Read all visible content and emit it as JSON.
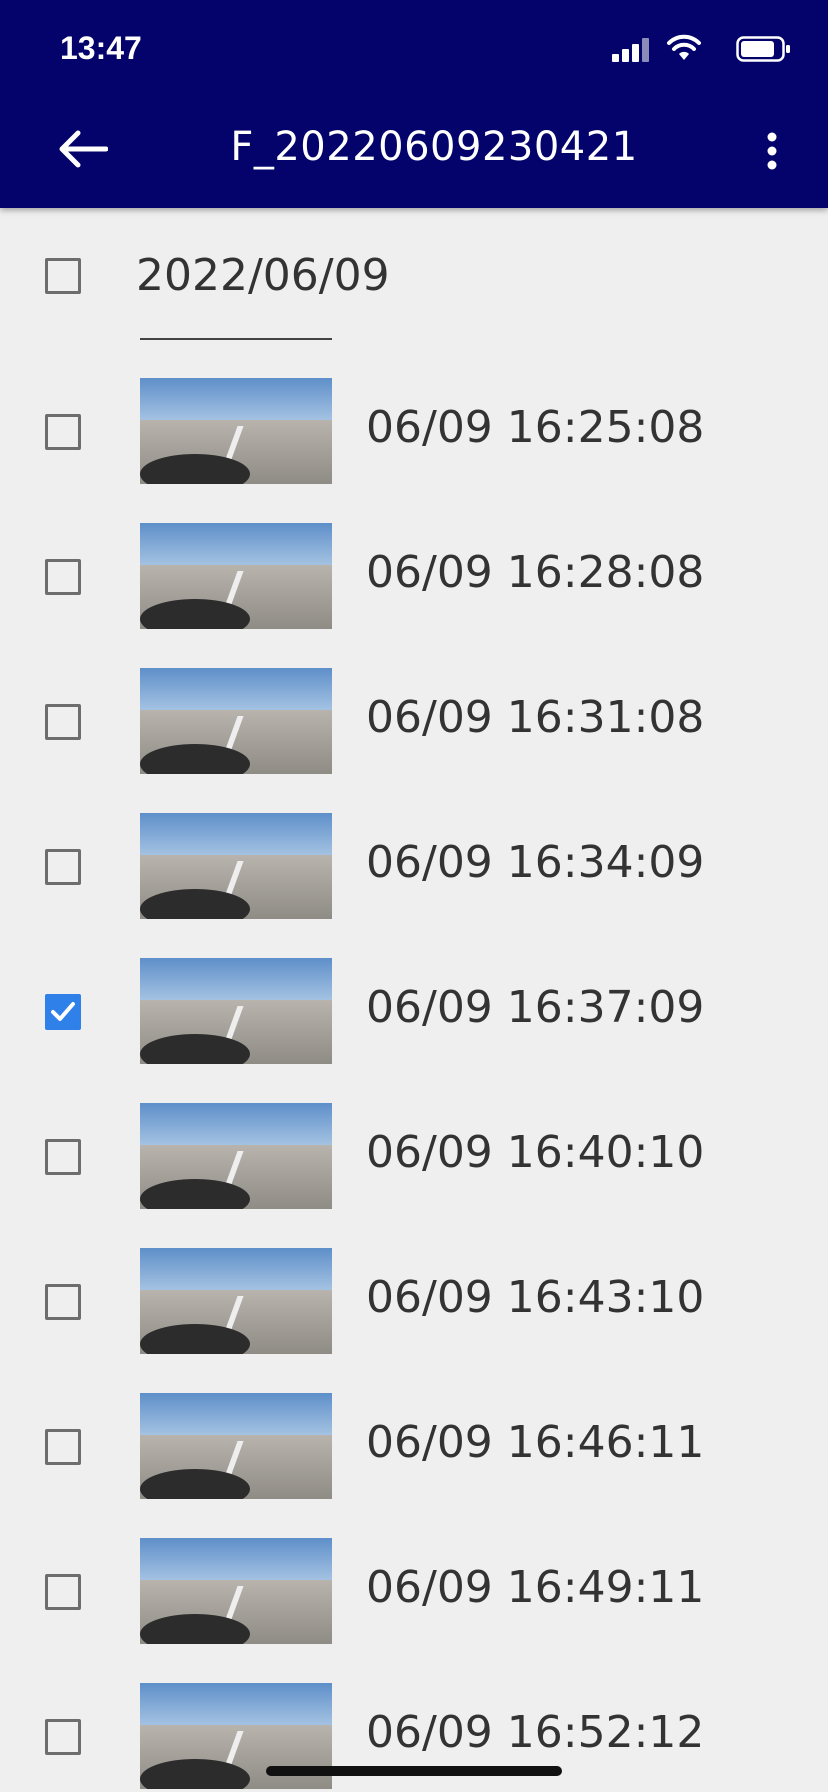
{
  "status_bar": {
    "time": "13:47"
  },
  "header": {
    "title": "F_20220609230421"
  },
  "group": {
    "date": "2022/06/09",
    "checked": false
  },
  "items": [
    {
      "time": "06/09 16:25:08",
      "checked": false
    },
    {
      "time": "06/09 16:28:08",
      "checked": false
    },
    {
      "time": "06/09 16:31:08",
      "checked": false
    },
    {
      "time": "06/09 16:34:09",
      "checked": false
    },
    {
      "time": "06/09 16:37:09",
      "checked": true
    },
    {
      "time": "06/09 16:40:10",
      "checked": false
    },
    {
      "time": "06/09 16:43:10",
      "checked": false
    },
    {
      "time": "06/09 16:46:11",
      "checked": false
    },
    {
      "time": "06/09 16:49:11",
      "checked": false
    },
    {
      "time": "06/09 16:52:12",
      "checked": false
    }
  ],
  "colors": {
    "header_bg": "#03036b",
    "page_bg": "#efefef",
    "checkbox_checked": "#2f80e8"
  }
}
